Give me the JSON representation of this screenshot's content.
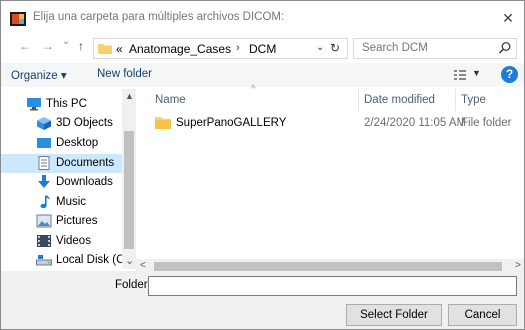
{
  "window": {
    "title": "Elija una carpeta para múltiples archivos DICOM:",
    "close_glyph": "✕"
  },
  "nav": {
    "back": "←",
    "forward": "→",
    "dropdown": "⌄",
    "up": "↑"
  },
  "address": {
    "overflow": "«",
    "crumbs": [
      "Anatomage_Cases",
      "DCM"
    ],
    "separator": "›",
    "dropdown": "⌄",
    "refresh": "↻"
  },
  "search": {
    "placeholder": "Search DCM"
  },
  "toolbar": {
    "organize": "Organize ▾",
    "new_folder": "New folder",
    "view_dropdown": "▼",
    "help": "?"
  },
  "sidebar": {
    "items": [
      {
        "label": "This PC",
        "icon": "pc-icon",
        "selected": false
      },
      {
        "label": "3D Objects",
        "icon": "3d-objects-icon",
        "selected": false
      },
      {
        "label": "Desktop",
        "icon": "desktop-icon",
        "selected": false
      },
      {
        "label": "Documents",
        "icon": "documents-icon",
        "selected": true
      },
      {
        "label": "Downloads",
        "icon": "downloads-icon",
        "selected": false
      },
      {
        "label": "Music",
        "icon": "music-icon",
        "selected": false
      },
      {
        "label": "Pictures",
        "icon": "pictures-icon",
        "selected": false
      },
      {
        "label": "Videos",
        "icon": "videos-icon",
        "selected": false
      },
      {
        "label": "Local Disk (C:)",
        "icon": "disk-icon",
        "selected": false
      }
    ],
    "scroll_up": "▲",
    "scroll_down": "⌄"
  },
  "columns": {
    "name": "Name",
    "date": "Date modified",
    "type": "Type",
    "sort_glyph": "^"
  },
  "files": [
    {
      "name": "SuperPanoGALLERY",
      "date": "2/24/2020 11:05 AM",
      "type": "File folder"
    }
  ],
  "hscroll": {
    "left": "<",
    "right": ">"
  },
  "footer": {
    "folder_label": "Folder:",
    "folder_value": "",
    "select_button": "Select Folder",
    "cancel_button": "Cancel"
  },
  "colors": {
    "accent": "#1f7bd6",
    "selection": "#cce8ff",
    "folder": "#f8d16a"
  }
}
